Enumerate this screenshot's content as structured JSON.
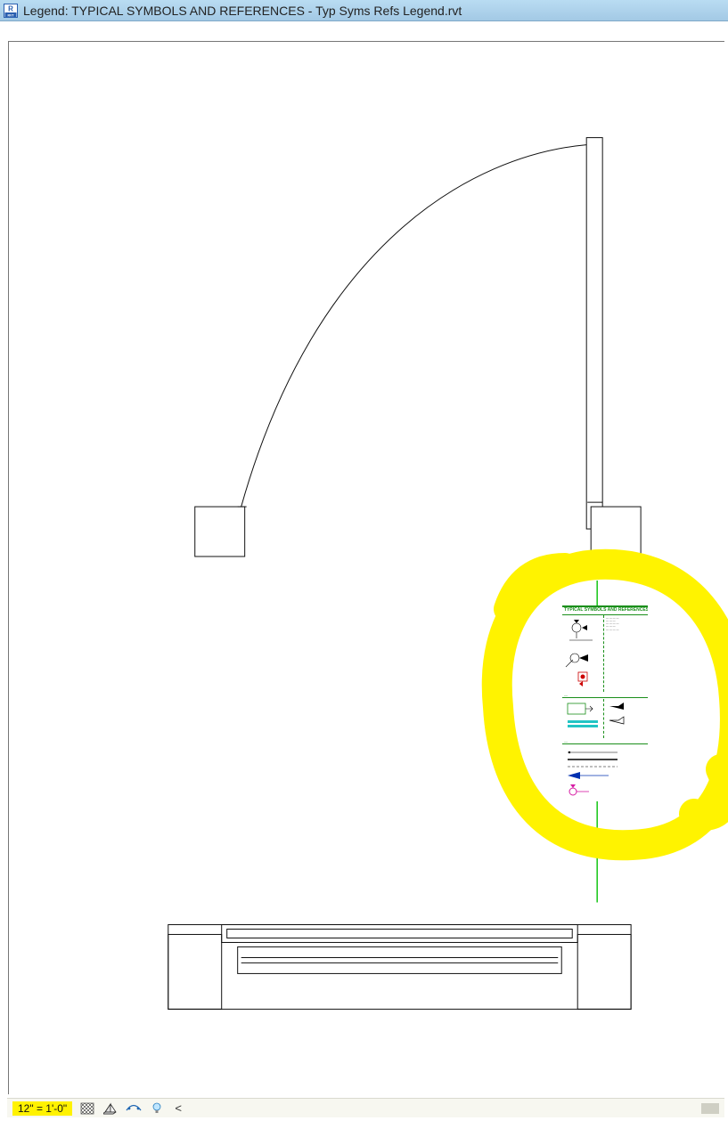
{
  "titlebar": {
    "app_icon_label": "R",
    "app_icon_sub": "RVT",
    "text": "Legend: TYPICAL SYMBOLS AND REFERENCES - Typ Syms Refs Legend.rvt"
  },
  "inset": {
    "heading": "TYPICAL SYMBOLS AND REFERENCES"
  },
  "statusbar": {
    "scale": "12\" = 1'-0\"",
    "expand_glyph": "<"
  }
}
